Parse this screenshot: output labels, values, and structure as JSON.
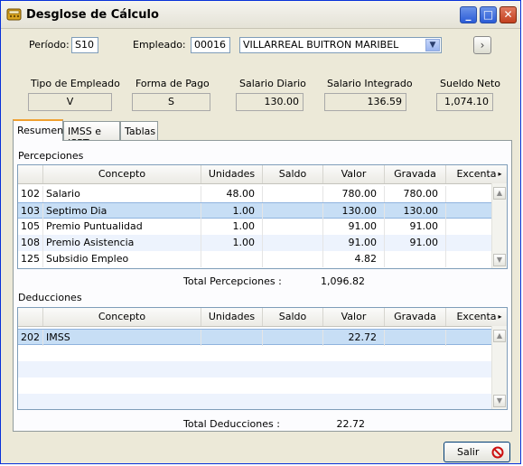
{
  "window": {
    "title": "Desglose de Cálculo",
    "min": "_",
    "max": "□",
    "close": "✕"
  },
  "header": {
    "periodo_label": "Período:",
    "periodo_value": "S10",
    "empleado_label": "Empleado:",
    "empleado_value": "00016",
    "empleado_name": "VILLARREAL BUITRON MARIBEL"
  },
  "info": [
    {
      "label": "Tipo de Empleado",
      "value": "V"
    },
    {
      "label": "Forma de Pago",
      "value": "S"
    },
    {
      "label": "Salario Diario",
      "value": "130.00"
    },
    {
      "label": "Salario Integrado",
      "value": "136.59"
    },
    {
      "label": "Sueldo Neto",
      "value": "1,074.10"
    }
  ],
  "tabs": [
    "Resumen",
    "IMSS e ISPT",
    "Tablas"
  ],
  "percepciones": {
    "title": "Percepciones",
    "columns": [
      "Concepto",
      "Unidades",
      "Saldo",
      "Valor",
      "Gravada",
      "Excenta"
    ],
    "rows": [
      {
        "code": "102",
        "concepto": "Salario",
        "unidades": "48.00",
        "saldo": "",
        "valor": "780.00",
        "gravada": "780.00",
        "excenta": ""
      },
      {
        "code": "103",
        "concepto": "Septimo Dia",
        "unidades": "1.00",
        "saldo": "",
        "valor": "130.00",
        "gravada": "130.00",
        "excenta": ""
      },
      {
        "code": "105",
        "concepto": "Premio Puntualidad",
        "unidades": "1.00",
        "saldo": "",
        "valor": "91.00",
        "gravada": "91.00",
        "excenta": ""
      },
      {
        "code": "108",
        "concepto": "Premio Asistencia",
        "unidades": "1.00",
        "saldo": "",
        "valor": "91.00",
        "gravada": "91.00",
        "excenta": ""
      },
      {
        "code": "125",
        "concepto": "Subsidio Empleo",
        "unidades": "",
        "saldo": "",
        "valor": "4.82",
        "gravada": "",
        "excenta": ""
      }
    ],
    "total_label": "Total Percepciones :",
    "total_value": "1,096.82"
  },
  "deducciones": {
    "title": "Deducciones",
    "columns": [
      "Concepto",
      "Unidades",
      "Saldo",
      "Valor",
      "Gravada",
      "Excenta"
    ],
    "rows": [
      {
        "code": "202",
        "concepto": "IMSS",
        "unidades": "",
        "saldo": "",
        "valor": "22.72",
        "gravada": "",
        "excenta": ""
      }
    ],
    "total_label": "Total Deducciones :",
    "total_value": "22.72"
  },
  "footer": {
    "salir_label": "Salir"
  },
  "icons": {
    "app": "calculator-icon",
    "next": "chevron-right-icon",
    "combo": "chevron-down-icon",
    "salir": "no-entry-icon"
  },
  "colors": {
    "accent": "#f0a030",
    "selection": "#c7def5",
    "border": "#7f9db9",
    "salir_icon": "#cc1010"
  }
}
